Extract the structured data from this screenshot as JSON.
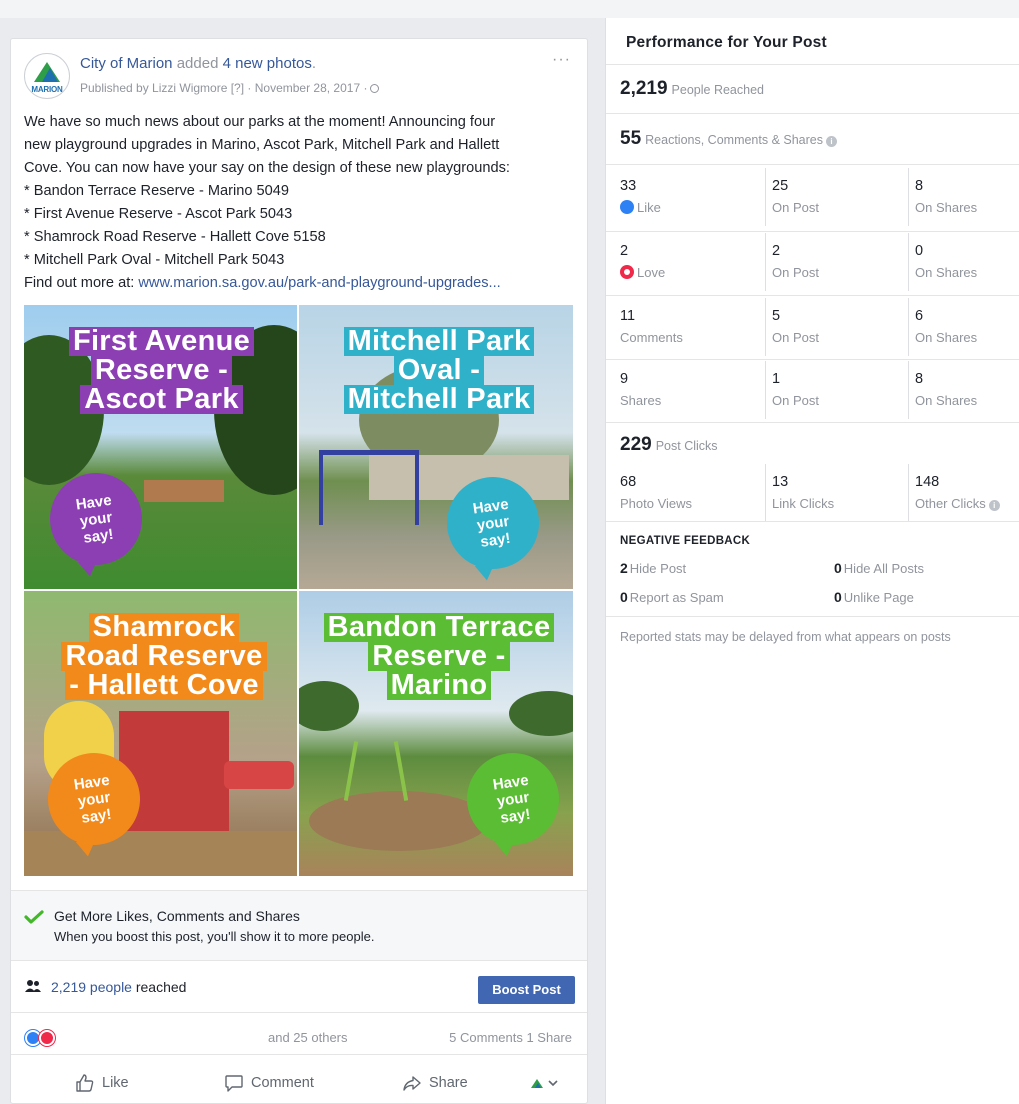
{
  "post": {
    "page_name": "City of Marion",
    "action_text": "added",
    "photos_link": "4 new photos",
    "period": ".",
    "published_by": "Published by Lizzi Wigmore [?] · November 28, 2017 ·",
    "avatar_text": "MARION",
    "more_label": "···",
    "text_lines": [
      "We have so much news about our parks at the moment! Announcing four",
      "new playground upgrades in Marino, Ascot Park, Mitchell Park and Hallett",
      "Cove. You can now have your say on the design of these new playgrounds:",
      "* Bandon Terrace Reserve - Marino 5049",
      "* First Avenue Reserve - Ascot Park 5043",
      "* Shamrock Road Reserve - Hallett Cove 5158",
      "* Mitchell Park Oval - Mitchell Park 5043"
    ],
    "find_more_prefix": "Find out more at:",
    "find_more_link": "www.marion.sa.gov.au/park-and-playground-upgrades..."
  },
  "tiles": [
    {
      "title_lines": [
        "First Avenue",
        "Reserve -",
        "Ascot Park"
      ],
      "bubble": [
        "Have",
        "your",
        "say!"
      ],
      "color": "#8c3fb3"
    },
    {
      "title_lines": [
        "Mitchell Park",
        "Oval -",
        "Mitchell Park"
      ],
      "bubble": [
        "Have",
        "your",
        "say!"
      ],
      "color": "#2fb1c9"
    },
    {
      "title_lines": [
        "Shamrock",
        "Road Reserve",
        "- Hallett Cove"
      ],
      "bubble": [
        "Have",
        "your",
        "say!"
      ],
      "color": "#f28a1b"
    },
    {
      "title_lines": [
        "Bandon Terrace",
        "Reserve -",
        "Marino"
      ],
      "bubble": [
        "Have",
        "your",
        "say!"
      ],
      "color": "#5bbd34"
    }
  ],
  "boost_tip": {
    "title": "Get More Likes, Comments and Shares",
    "subtitle": "When you boost this post, you'll show it to more people."
  },
  "reach": {
    "count_link": "2,219 people",
    "suffix": "reached",
    "boost_label": "Boost Post"
  },
  "reactions": {
    "others_text": "and 25 others",
    "comments_shares": "5 Comments  1 Share"
  },
  "actions": {
    "like": "Like",
    "comment": "Comment",
    "share": "Share"
  },
  "performance": {
    "title": "Performance for Your Post",
    "reached_num": "2,219",
    "reached_label": "People Reached",
    "engagement_num": "55",
    "engagement_label": "Reactions, Comments & Shares",
    "rows": [
      {
        "c1v": "33",
        "c1l": "Like",
        "c2v": "25",
        "c2l": "On Post",
        "c3v": "8",
        "c3l": "On Shares"
      },
      {
        "c1v": "2",
        "c1l": "Love",
        "c2v": "2",
        "c2l": "On Post",
        "c3v": "0",
        "c3l": "On Shares"
      },
      {
        "c1v": "11",
        "c1l": "Comments",
        "c2v": "5",
        "c2l": "On Post",
        "c3v": "6",
        "c3l": "On Shares"
      },
      {
        "c1v": "9",
        "c1l": "Shares",
        "c2v": "1",
        "c2l": "On Post",
        "c3v": "8",
        "c3l": "On Shares"
      }
    ],
    "clicks_num": "229",
    "clicks_label": "Post Clicks",
    "clicks_row": {
      "c1v": "68",
      "c1l": "Photo Views",
      "c2v": "13",
      "c2l": "Link Clicks",
      "c3v": "148",
      "c3l": "Other Clicks"
    },
    "negative_title": "NEGATIVE FEEDBACK",
    "negative": {
      "hide_post_n": "2",
      "hide_post_l": "Hide Post",
      "hide_all_n": "0",
      "hide_all_l": "Hide All Posts",
      "spam_n": "0",
      "spam_l": "Report as Spam",
      "unlike_n": "0",
      "unlike_l": "Unlike Page"
    },
    "note": "Reported stats may be delayed from what appears on posts",
    "info_glyph": "i"
  },
  "colors": {
    "link": "#365899",
    "boost_button": "#4267b2",
    "like_blue": "#2e81f4",
    "love_red": "#f0284a",
    "muted": "#90949c"
  }
}
